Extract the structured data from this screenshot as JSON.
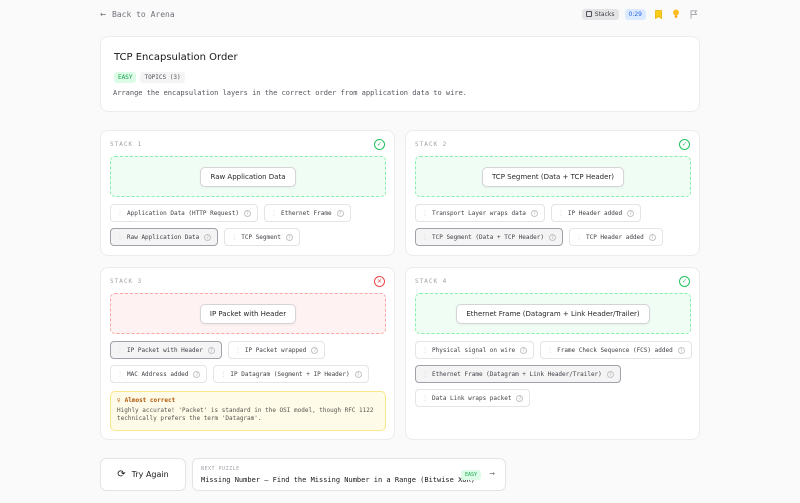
{
  "nav": {
    "back_label": "Back to Arena",
    "stacks_label": "Stacks",
    "timer": "0:29"
  },
  "puzzle": {
    "title": "TCP Encapsulation Order",
    "difficulty": "EASY",
    "topics": "TOPICS (3)",
    "description": "Arrange the encapsulation layers in the correct order from application data to wire."
  },
  "stacks": [
    {
      "label": "STACK 1",
      "status": "correct",
      "placed": "Raw Application Data",
      "chips": [
        [
          "Application Data (HTTP Request)",
          "Ethernet Frame"
        ],
        [
          "Raw Application Data",
          "TCP Segment"
        ]
      ],
      "selected": "Raw Application Data"
    },
    {
      "label": "STACK 2",
      "status": "correct",
      "placed": "TCP Segment (Data + TCP Header)",
      "chips": [
        [
          "Transport Layer wraps data",
          "IP Header added"
        ],
        [
          "TCP Segment (Data + TCP Header)",
          "TCP Header added"
        ]
      ],
      "selected": "TCP Segment (Data + TCP Header)"
    },
    {
      "label": "STACK 3",
      "status": "incorrect",
      "placed": "IP Packet with Header",
      "chips": [
        [
          "IP Packet with Header",
          "IP Packet wrapped"
        ],
        [
          "MAC Address added",
          "IP Datagram (Segment + IP Header)"
        ]
      ],
      "selected": "IP Packet with Header",
      "feedback": {
        "title": "Almost correct",
        "body": "Highly accurate! 'Packet' is standard in the OSI model, though RFC 1122 technically prefers the term 'Datagram'."
      }
    },
    {
      "label": "STACK 4",
      "status": "correct",
      "placed": "Ethernet Frame (Datagram + Link Header/Trailer)",
      "chips": [
        [
          "Physical signal on wire",
          "Frame Check Sequence (FCS) added"
        ],
        [
          "Ethernet Frame (Datagram + Link Header/Trailer)"
        ],
        [
          "Data Link wraps packet"
        ]
      ],
      "selected": "Ethernet Frame (Datagram + Link Header/Trailer)"
    }
  ],
  "footer": {
    "try_again": "Try Again",
    "next_label": "NEXT PUZZLE",
    "next_title": "Missing Number — Find the Missing Number in a Range (Bitwise XOR)",
    "next_difficulty": "EASY"
  },
  "colors": {
    "correct": "#22c55e",
    "incorrect": "#ef4444",
    "accent_blue": "#2563eb",
    "warning": "#b45309"
  },
  "icons": {
    "back": "arrow-left-icon",
    "status_correct": "check-circle-icon",
    "status_incorrect": "x-circle-icon",
    "retry": "refresh-icon",
    "next": "arrow-right-icon"
  }
}
